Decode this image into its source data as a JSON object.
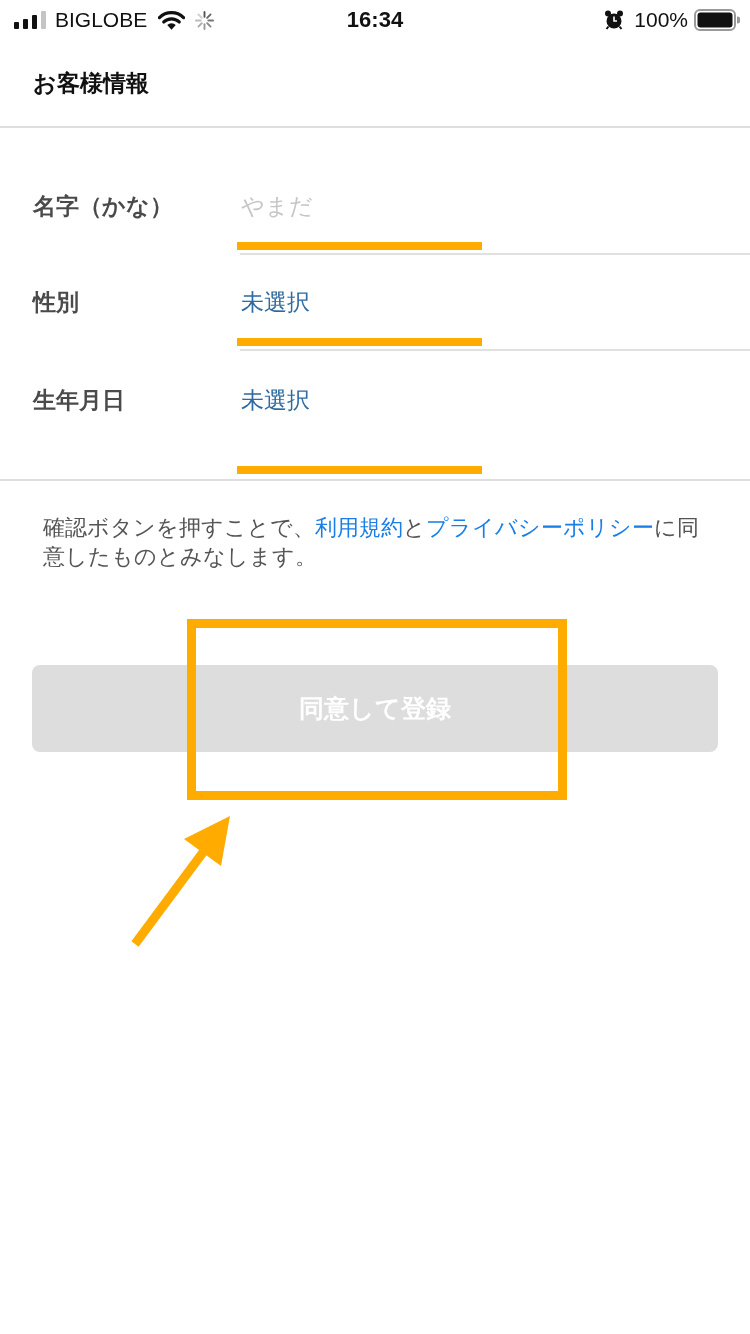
{
  "status_bar": {
    "carrier": "BIGLOBE",
    "time": "16:34",
    "battery": "100%"
  },
  "header": {
    "title": "お客様情報"
  },
  "fields": [
    {
      "kind": "text",
      "label": "名字（かな）",
      "placeholder": "やまだ",
      "highlighted": true
    },
    {
      "kind": "select",
      "label": "性別",
      "value": "未選択",
      "highlighted": true
    },
    {
      "kind": "select",
      "label": "生年月日",
      "value": "未選択",
      "highlighted": true
    }
  ],
  "notice": {
    "parts": [
      {
        "text": "確認ボタンを押すことで、",
        "link": false
      },
      {
        "text": "利用規約",
        "link": true
      },
      {
        "text": "と",
        "link": false
      },
      {
        "text": "プライバシーポリシー",
        "link": true
      },
      {
        "text": "に同意したものとみなします。",
        "link": false
      }
    ]
  },
  "button": {
    "label": "同意して登録",
    "disabled": true,
    "highlighted": true
  }
}
